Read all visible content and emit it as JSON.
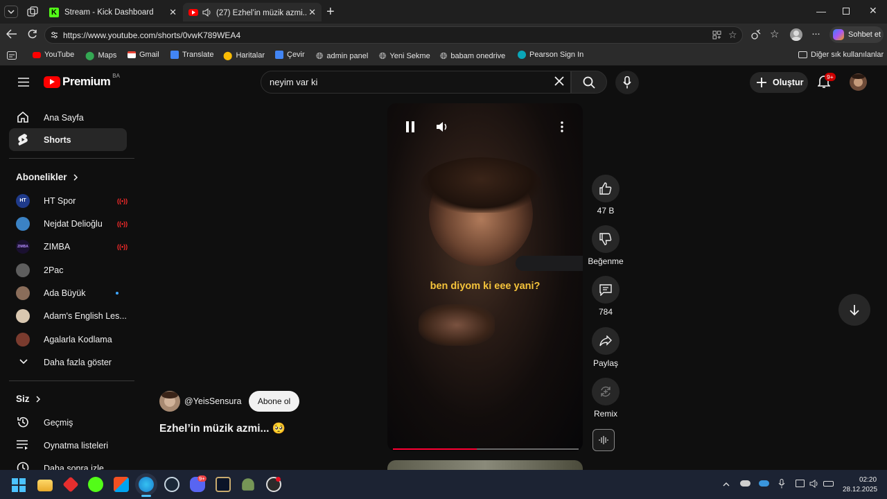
{
  "browser": {
    "tabs": [
      {
        "title": "Stream - Kick Dashboard",
        "active": false
      },
      {
        "title": "(27) Ezhel’in müzik azmi... 🥺",
        "active": true
      }
    ],
    "url": "https://www.youtube.com/shorts/0vwK789WEA4",
    "copilot_label": "Sohbet et",
    "bookmarks": [
      "YouTube",
      "Maps",
      "Gmail",
      "Translate",
      "Haritalar",
      "Çevir",
      "admin panel",
      "Yeni Sekme",
      "babam onedrive",
      "Pearson Sign In"
    ],
    "other_bookmarks": "Diğer sık kullanılanlar"
  },
  "youtube": {
    "logo_text": "Premium",
    "logo_badge": "BA",
    "search": {
      "value": "neyim var ki"
    },
    "create_label": "Oluştur",
    "notification_count": "9+",
    "sidebar": {
      "main": [
        {
          "label": "Ana Sayfa",
          "icon": "home-icon"
        },
        {
          "label": "Shorts",
          "icon": "shorts-icon",
          "active": true
        }
      ],
      "subscriptions_title": "Abonelikler",
      "subscriptions": [
        {
          "label": "HT Spor",
          "live": true,
          "color": "#1f3a8a",
          "avatar_text": "HT"
        },
        {
          "label": "Nejdat Delioğlu",
          "live": true,
          "color": "#3b82c4"
        },
        {
          "label": "ZIMBA",
          "live": true,
          "color": "#6d28d9",
          "avatar_text": "ZIMBA"
        },
        {
          "label": "2Pac",
          "live": false,
          "color": "#6b6b6b"
        },
        {
          "label": "Ada Büyük",
          "live": false,
          "new": true,
          "color": "#8a6d5a"
        },
        {
          "label": "Adam's English Les...",
          "live": false,
          "color": "#d9c7b0"
        },
        {
          "label": "Agalarla Kodlama",
          "live": false,
          "color": "#7a3b2e"
        }
      ],
      "show_more": "Daha fazla göster",
      "you_title": "Siz",
      "you_items": [
        {
          "label": "Geçmiş",
          "icon": "history-icon"
        },
        {
          "label": "Oynatma listeleri",
          "icon": "playlist-icon"
        },
        {
          "label": "Daha sonra izle",
          "icon": "clock-icon"
        }
      ]
    },
    "short": {
      "caption": "ben diyom ki eee yani?",
      "channel": "@YeisSensura",
      "subscribe": "Abone ol",
      "title": "Ezhel’in müzik azmi... 🥺",
      "progress": 0.45
    },
    "actions": [
      {
        "label": "47 B",
        "icon": "like-icon"
      },
      {
        "label": "Beğenme",
        "icon": "dislike-icon"
      },
      {
        "label": "784",
        "icon": "comment-icon"
      },
      {
        "label": "Paylaş",
        "icon": "share-icon"
      },
      {
        "label": "Remix",
        "icon": "remix-icon"
      }
    ]
  },
  "taskbar": {
    "time": "02:20",
    "date": "28.12.2025",
    "discord_badge": "9+"
  },
  "colors": {
    "yt_red": "#ff0000",
    "caption_yellow": "#f5c33b",
    "live_red": "#ff2b2b",
    "kick_green": "#53fc18"
  }
}
